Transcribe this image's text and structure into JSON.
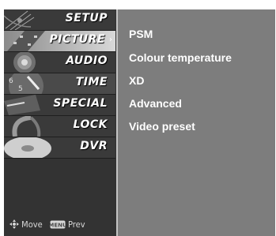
{
  "menu": {
    "items": [
      {
        "label": "SETUP",
        "icon": "satellite-dish-icon"
      },
      {
        "label": "PICTURE",
        "icon": "film-strip-icon"
      },
      {
        "label": "AUDIO",
        "icon": "speaker-icon"
      },
      {
        "label": "TIME",
        "icon": "clock-icon"
      },
      {
        "label": "SPECIAL",
        "icon": "special-tag-icon"
      },
      {
        "label": "LOCK",
        "icon": "lock-icon"
      },
      {
        "label": "DVR",
        "icon": "disc-icon"
      }
    ],
    "active_index": 1,
    "active_arrow": "›"
  },
  "submenu": {
    "items": [
      "PSM",
      "Colour temperature",
      "XD",
      "Advanced",
      "Video preset"
    ]
  },
  "help": {
    "move_label": "Move",
    "menu_key": "MENU",
    "prev_label": "Prev"
  }
}
